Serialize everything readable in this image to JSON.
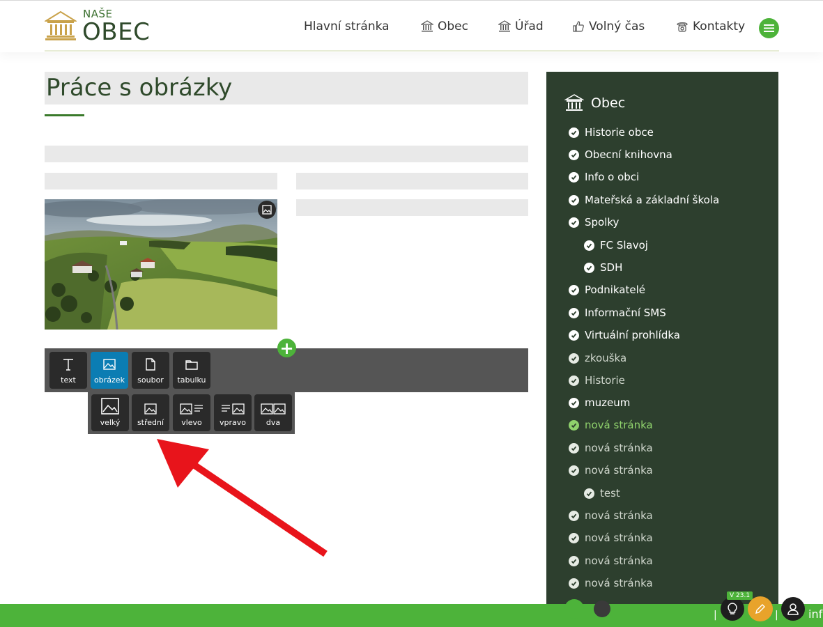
{
  "header": {
    "logo_top": "NAŠE",
    "logo_main": "OBEC",
    "nav": [
      {
        "label": "Hlavní stránka",
        "icon": "none"
      },
      {
        "label": "Obec",
        "icon": "building-icon"
      },
      {
        "label": "Úřad",
        "icon": "building-icon"
      },
      {
        "label": "Volný čas",
        "icon": "thumbs-up-icon"
      },
      {
        "label": "Kontakty",
        "icon": "phone-icon"
      }
    ]
  },
  "main": {
    "page_title": "Práce s obrázky"
  },
  "toolbar": {
    "buttons": [
      {
        "label": "text",
        "icon": "text-icon"
      },
      {
        "label": "obrázek",
        "icon": "image-icon"
      },
      {
        "label": "soubor",
        "icon": "file-icon"
      },
      {
        "label": "tabulku",
        "icon": "folder-icon"
      }
    ],
    "image_options": [
      {
        "label": "velký"
      },
      {
        "label": "střední"
      },
      {
        "label": "vlevo"
      },
      {
        "label": "vpravo"
      },
      {
        "label": "dva"
      }
    ]
  },
  "sidebar": {
    "title": "Obec",
    "items": [
      {
        "label": "Historie obce"
      },
      {
        "label": "Obecní knihovna"
      },
      {
        "label": "Info o obci"
      },
      {
        "label": "Mateřská a základní škola"
      },
      {
        "label": "Spolky"
      },
      {
        "label": "FC Slavoj"
      },
      {
        "label": "SDH"
      },
      {
        "label": "Podnikatelé"
      },
      {
        "label": "Informační SMS"
      },
      {
        "label": "Virtuální prohlídka"
      },
      {
        "label": "zkouška"
      },
      {
        "label": "Historie"
      },
      {
        "label": "muzeum"
      },
      {
        "label": "nová stránka"
      },
      {
        "label": "nová stránka"
      },
      {
        "label": "nová stránka"
      },
      {
        "label": "test"
      },
      {
        "label": "nová stránka"
      },
      {
        "label": "nová stránka"
      },
      {
        "label": "nová stránka"
      },
      {
        "label": "nová stránka"
      }
    ]
  },
  "footer": {
    "version": "V 23.1",
    "sep": "|",
    "user_text": "inf"
  },
  "colors": {
    "accent_green": "#4db33a",
    "sidebar_bg": "#2d3f2e",
    "active_blue": "#0b7db3",
    "highlight_green": "#8fd16c",
    "edit_orange": "#e8a32b"
  }
}
